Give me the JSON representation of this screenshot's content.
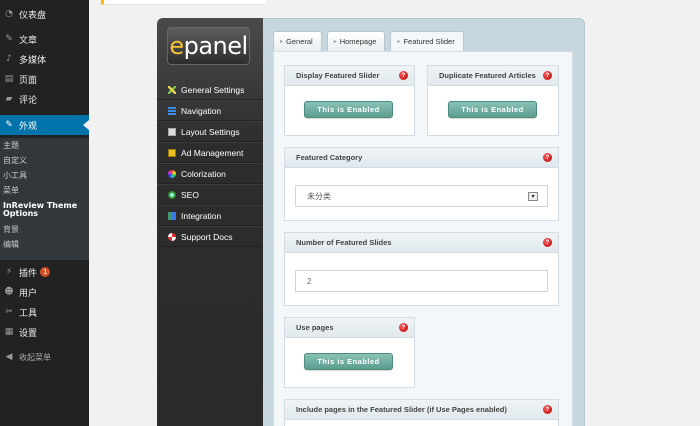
{
  "wp_menu": {
    "items": [
      {
        "label": "仪表盘",
        "icon": "dashboard-icon",
        "glyph": "◔"
      },
      {
        "label": "文章",
        "icon": "pin-icon",
        "glyph": "✎"
      },
      {
        "label": "多媒体",
        "icon": "media-icon",
        "glyph": "♪"
      },
      {
        "label": "页面",
        "icon": "page-icon",
        "glyph": "▤"
      },
      {
        "label": "评论",
        "icon": "comment-icon",
        "glyph": "▰"
      },
      {
        "label": "外观",
        "icon": "appearance-icon",
        "glyph": "✎"
      }
    ],
    "appearance_sub": [
      "主题",
      "自定义",
      "小工具",
      "菜单",
      "InReview Theme Options",
      "背景",
      "编辑"
    ],
    "lower_items": [
      {
        "label": "插件",
        "icon": "plugin-icon",
        "glyph": "⚡",
        "badge": "1"
      },
      {
        "label": "用户",
        "icon": "user-icon",
        "glyph": "☻"
      },
      {
        "label": "工具",
        "icon": "wrench-icon",
        "glyph": "✂"
      },
      {
        "label": "设置",
        "icon": "settings-icon",
        "glyph": "▦"
      },
      {
        "label": "收起菜单",
        "icon": "collapse-icon",
        "glyph": "◀"
      }
    ]
  },
  "epanel": {
    "logo_e": "e",
    "logo_rest": "panel",
    "nav": [
      {
        "label": "General Settings",
        "icon": "general-settings-icon",
        "color": "#e5d24a"
      },
      {
        "label": "Navigation",
        "icon": "navigation-icon",
        "color": "#3a8ee6"
      },
      {
        "label": "Layout Settings",
        "icon": "layout-icon",
        "color": "#dddddd"
      },
      {
        "label": "Ad Management",
        "icon": "ad-icon",
        "color": "#e8c020"
      },
      {
        "label": "Colorization",
        "icon": "colorization-icon",
        "color": "#55aadd"
      },
      {
        "label": "SEO",
        "icon": "seo-icon",
        "color": "#4caf50"
      },
      {
        "label": "Integration",
        "icon": "integration-icon",
        "color": "#3a9a6a"
      },
      {
        "label": "Support Docs",
        "icon": "support-icon",
        "color": "#e03030"
      }
    ],
    "tabs": [
      "General",
      "Homepage",
      "Featured Slider"
    ],
    "options": {
      "display_slider": {
        "title": "Display Featured Slider",
        "button": "This is Enabled"
      },
      "duplicate_articles": {
        "title": "Duplicate Featured Articles",
        "button": "This is Enabled"
      },
      "category": {
        "title": "Featured Category",
        "value": "未分类"
      },
      "num_slides": {
        "title": "Number of Featured Slides",
        "value": "2"
      },
      "use_pages": {
        "title": "Use pages",
        "button": "This is Enabled"
      },
      "include_pages": {
        "title": "Include pages in the Featured Slider (if Use Pages enabled)"
      }
    },
    "help_glyph": "?",
    "dropdown_glyph": "▾"
  },
  "colors": {
    "wp_active": "#0073aa",
    "toggle": "#6aab9e",
    "help": "#cc0000"
  }
}
